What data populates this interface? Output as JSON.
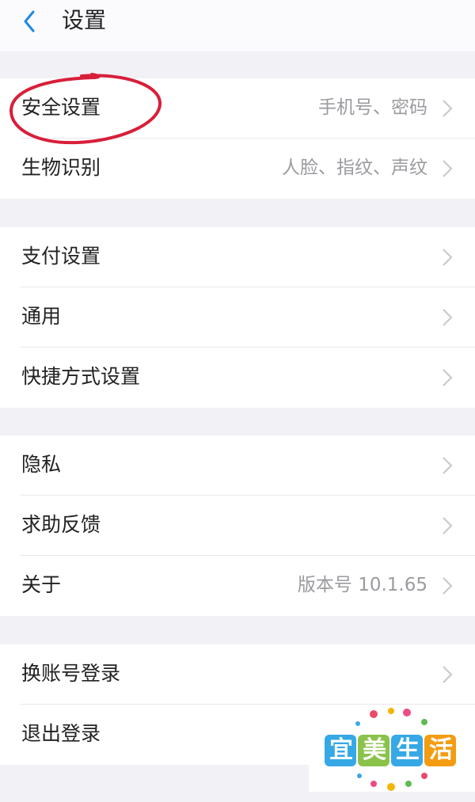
{
  "header": {
    "title": "设置",
    "back_icon": "chevron-left-icon"
  },
  "groups": [
    {
      "items": [
        {
          "label": "安全设置",
          "value": "手机号、密码"
        },
        {
          "label": "生物识别",
          "value": "人脸、指纹、声纹"
        }
      ]
    },
    {
      "items": [
        {
          "label": "支付设置",
          "value": ""
        },
        {
          "label": "通用",
          "value": ""
        },
        {
          "label": "快捷方式设置",
          "value": ""
        }
      ]
    },
    {
      "items": [
        {
          "label": "隐私",
          "value": ""
        },
        {
          "label": "求助反馈",
          "value": ""
        },
        {
          "label": "关于",
          "value": "版本号 10.1.65"
        }
      ]
    },
    {
      "items": [
        {
          "label": "换账号登录",
          "value": ""
        },
        {
          "label": "退出登录",
          "value": ""
        }
      ]
    }
  ],
  "watermark": {
    "text": "宜美生活"
  },
  "colors": {
    "accent": "#1e88e5",
    "annotation": "#d81f3a",
    "page_bg": "#f2f1f5"
  }
}
